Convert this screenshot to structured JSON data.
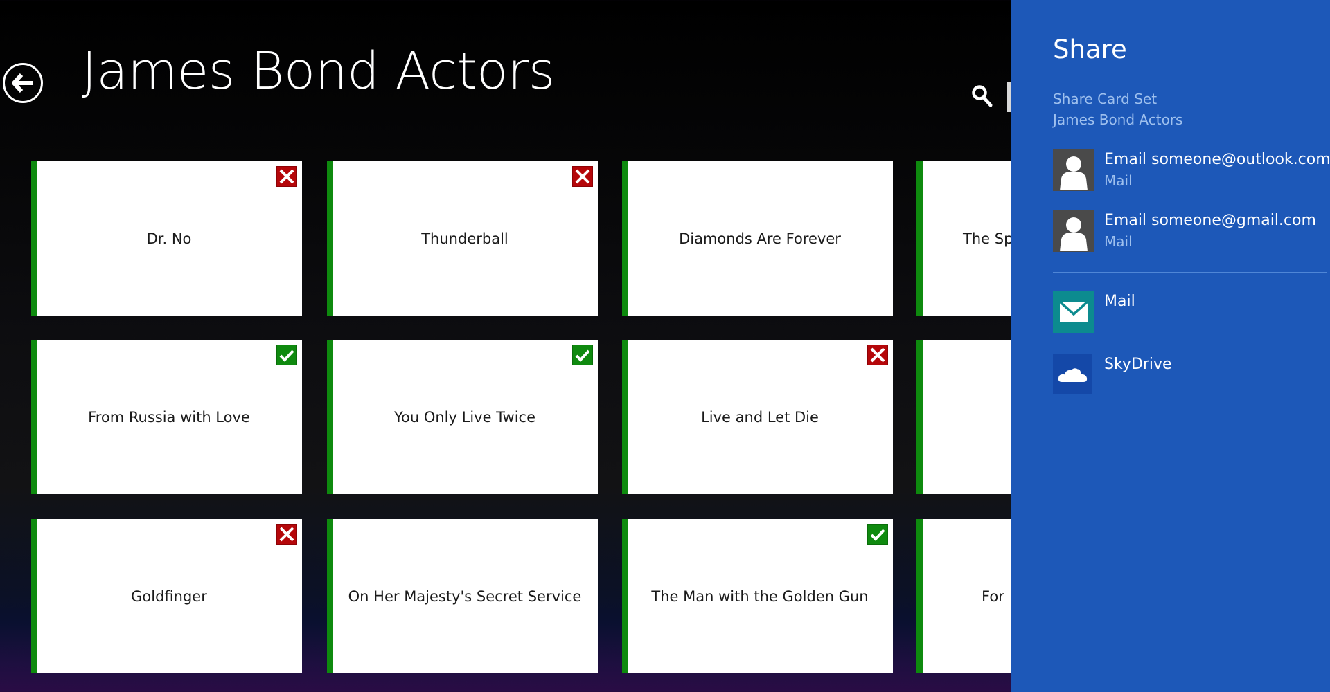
{
  "header": {
    "title": "James Bond Actors",
    "back_icon": "back-arrow-icon",
    "search_icon": "search-icon"
  },
  "cards": [
    {
      "title": "Dr. No",
      "status": "wrong"
    },
    {
      "title": "Thunderball",
      "status": "wrong"
    },
    {
      "title": "Diamonds Are Forever",
      "status": "none"
    },
    {
      "title": "The Sp",
      "status": "none"
    },
    {
      "title": "From Russia with Love",
      "status": "right"
    },
    {
      "title": "You Only Live Twice",
      "status": "right"
    },
    {
      "title": "Live and Let Die",
      "status": "wrong"
    },
    {
      "title": "",
      "status": "none"
    },
    {
      "title": "Goldfinger",
      "status": "wrong"
    },
    {
      "title": "On Her Majesty's Secret Service",
      "status": "none"
    },
    {
      "title": "The Man with the Golden Gun",
      "status": "right"
    },
    {
      "title": "For",
      "status": "none"
    }
  ],
  "colors": {
    "card_accent": "#0e8a0e",
    "wrong_badge": "#b5070a",
    "right_badge": "#0f8a0f",
    "share_panel": "#1d58b8",
    "mail_tile": "#0c8b8f",
    "skydrive_tile": "#1448a8"
  },
  "share": {
    "title": "Share",
    "subtitle_line1": "Share Card Set",
    "subtitle_line2": "James Bond Actors",
    "contacts": [
      {
        "label": "Email someone@outlook.com",
        "app": "Mail",
        "icon": "person-icon"
      },
      {
        "label": "Email someone@gmail.com",
        "app": "Mail",
        "icon": "person-icon"
      }
    ],
    "apps": [
      {
        "label": "Mail",
        "icon": "mail-icon"
      },
      {
        "label": "SkyDrive",
        "icon": "cloud-icon"
      }
    ]
  }
}
